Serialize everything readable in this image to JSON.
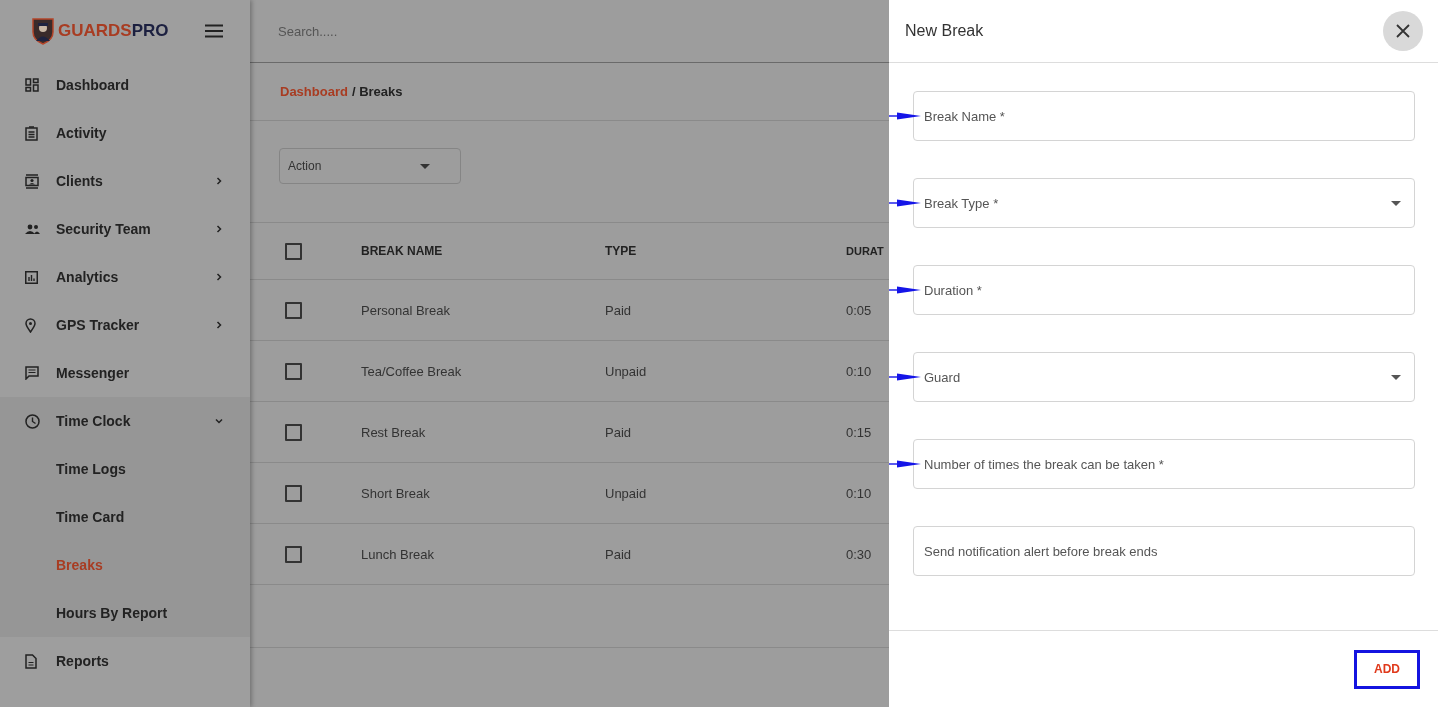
{
  "sidebar": {
    "logo": {
      "part_1": "GUARDS",
      "part_2": "PRO"
    },
    "items": [
      {
        "label": "Dashboard",
        "has_submenu": false,
        "selected": false
      },
      {
        "label": "Activity",
        "has_submenu": false,
        "selected": false
      },
      {
        "label": "Clients",
        "has_submenu": true,
        "expanded": false,
        "selected": false
      },
      {
        "label": "Security Team",
        "has_submenu": true,
        "expanded": false,
        "selected": false
      },
      {
        "label": "Analytics",
        "has_submenu": true,
        "expanded": false,
        "selected": false
      },
      {
        "label": "GPS Tracker",
        "has_submenu": true,
        "expanded": false,
        "selected": false
      },
      {
        "label": "Messenger",
        "has_submenu": false,
        "selected": false
      },
      {
        "label": "Time Clock",
        "has_submenu": true,
        "expanded": true,
        "selected": false,
        "children": [
          {
            "label": "Time Logs",
            "selected": false
          },
          {
            "label": "Time Card",
            "selected": false
          },
          {
            "label": "Breaks",
            "selected": true
          },
          {
            "label": "Hours By Report",
            "selected": false
          }
        ]
      },
      {
        "label": "Reports",
        "has_submenu": false,
        "selected": false
      }
    ]
  },
  "search": {
    "placeholder": "Search....."
  },
  "breadcrumb": {
    "link": "Dashboard",
    "separator": "/",
    "current": "Breaks"
  },
  "action_select": {
    "value": "Action"
  },
  "table": {
    "columns": [
      "BREAK NAME",
      "TYPE",
      "DURAT"
    ],
    "header_checked": false,
    "rows": [
      {
        "checked": false,
        "cells": [
          "Personal Break",
          "Paid",
          "0:05"
        ]
      },
      {
        "checked": false,
        "cells": [
          "Tea/Coffee Break",
          "Unpaid",
          "0:10"
        ]
      },
      {
        "checked": false,
        "cells": [
          "Rest Break",
          "Paid",
          "0:15"
        ]
      },
      {
        "checked": false,
        "cells": [
          "Short Break",
          "Unpaid",
          "0:10"
        ]
      },
      {
        "checked": false,
        "cells": [
          "Lunch Break",
          "Paid",
          "0:30"
        ]
      }
    ]
  },
  "drawer": {
    "title": "New Break",
    "fields": [
      {
        "kind": "text",
        "placeholder": "Break Name *",
        "annotated": true
      },
      {
        "kind": "select",
        "placeholder": "Break Type *",
        "annotated": true
      },
      {
        "kind": "text",
        "placeholder": "Duration *",
        "annotated": true
      },
      {
        "kind": "select",
        "placeholder": "Guard",
        "annotated": true
      },
      {
        "kind": "text",
        "placeholder": "Number of times the break can be taken *",
        "annotated": true
      },
      {
        "kind": "text",
        "placeholder": "Send notification alert before break ends",
        "annotated": false
      }
    ],
    "add_button": {
      "label": "ADD",
      "highlighted": true
    }
  }
}
